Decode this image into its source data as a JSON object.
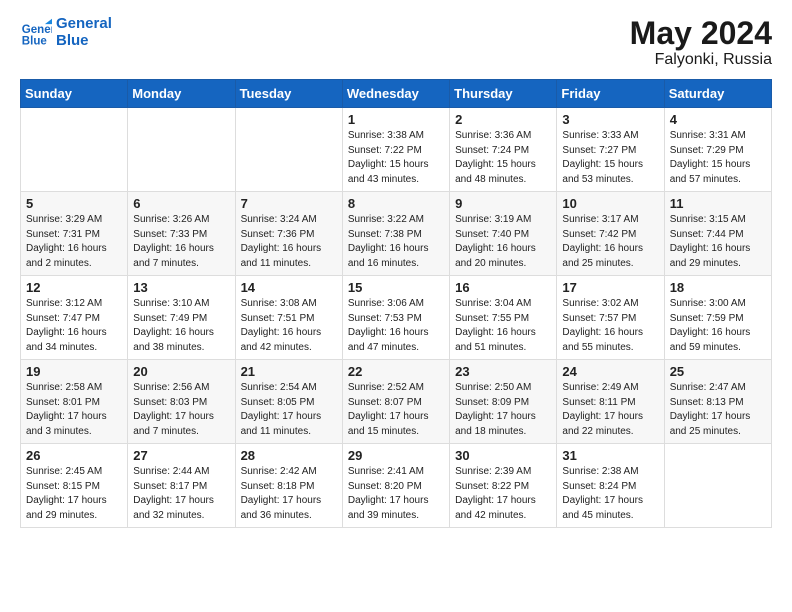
{
  "header": {
    "logo_line1": "General",
    "logo_line2": "Blue",
    "month": "May 2024",
    "location": "Falyonki, Russia"
  },
  "weekdays": [
    "Sunday",
    "Monday",
    "Tuesday",
    "Wednesday",
    "Thursday",
    "Friday",
    "Saturday"
  ],
  "weeks": [
    [
      {
        "day": "",
        "info": ""
      },
      {
        "day": "",
        "info": ""
      },
      {
        "day": "",
        "info": ""
      },
      {
        "day": "1",
        "info": "Sunrise: 3:38 AM\nSunset: 7:22 PM\nDaylight: 15 hours\nand 43 minutes."
      },
      {
        "day": "2",
        "info": "Sunrise: 3:36 AM\nSunset: 7:24 PM\nDaylight: 15 hours\nand 48 minutes."
      },
      {
        "day": "3",
        "info": "Sunrise: 3:33 AM\nSunset: 7:27 PM\nDaylight: 15 hours\nand 53 minutes."
      },
      {
        "day": "4",
        "info": "Sunrise: 3:31 AM\nSunset: 7:29 PM\nDaylight: 15 hours\nand 57 minutes."
      }
    ],
    [
      {
        "day": "5",
        "info": "Sunrise: 3:29 AM\nSunset: 7:31 PM\nDaylight: 16 hours\nand 2 minutes."
      },
      {
        "day": "6",
        "info": "Sunrise: 3:26 AM\nSunset: 7:33 PM\nDaylight: 16 hours\nand 7 minutes."
      },
      {
        "day": "7",
        "info": "Sunrise: 3:24 AM\nSunset: 7:36 PM\nDaylight: 16 hours\nand 11 minutes."
      },
      {
        "day": "8",
        "info": "Sunrise: 3:22 AM\nSunset: 7:38 PM\nDaylight: 16 hours\nand 16 minutes."
      },
      {
        "day": "9",
        "info": "Sunrise: 3:19 AM\nSunset: 7:40 PM\nDaylight: 16 hours\nand 20 minutes."
      },
      {
        "day": "10",
        "info": "Sunrise: 3:17 AM\nSunset: 7:42 PM\nDaylight: 16 hours\nand 25 minutes."
      },
      {
        "day": "11",
        "info": "Sunrise: 3:15 AM\nSunset: 7:44 PM\nDaylight: 16 hours\nand 29 minutes."
      }
    ],
    [
      {
        "day": "12",
        "info": "Sunrise: 3:12 AM\nSunset: 7:47 PM\nDaylight: 16 hours\nand 34 minutes."
      },
      {
        "day": "13",
        "info": "Sunrise: 3:10 AM\nSunset: 7:49 PM\nDaylight: 16 hours\nand 38 minutes."
      },
      {
        "day": "14",
        "info": "Sunrise: 3:08 AM\nSunset: 7:51 PM\nDaylight: 16 hours\nand 42 minutes."
      },
      {
        "day": "15",
        "info": "Sunrise: 3:06 AM\nSunset: 7:53 PM\nDaylight: 16 hours\nand 47 minutes."
      },
      {
        "day": "16",
        "info": "Sunrise: 3:04 AM\nSunset: 7:55 PM\nDaylight: 16 hours\nand 51 minutes."
      },
      {
        "day": "17",
        "info": "Sunrise: 3:02 AM\nSunset: 7:57 PM\nDaylight: 16 hours\nand 55 minutes."
      },
      {
        "day": "18",
        "info": "Sunrise: 3:00 AM\nSunset: 7:59 PM\nDaylight: 16 hours\nand 59 minutes."
      }
    ],
    [
      {
        "day": "19",
        "info": "Sunrise: 2:58 AM\nSunset: 8:01 PM\nDaylight: 17 hours\nand 3 minutes."
      },
      {
        "day": "20",
        "info": "Sunrise: 2:56 AM\nSunset: 8:03 PM\nDaylight: 17 hours\nand 7 minutes."
      },
      {
        "day": "21",
        "info": "Sunrise: 2:54 AM\nSunset: 8:05 PM\nDaylight: 17 hours\nand 11 minutes."
      },
      {
        "day": "22",
        "info": "Sunrise: 2:52 AM\nSunset: 8:07 PM\nDaylight: 17 hours\nand 15 minutes."
      },
      {
        "day": "23",
        "info": "Sunrise: 2:50 AM\nSunset: 8:09 PM\nDaylight: 17 hours\nand 18 minutes."
      },
      {
        "day": "24",
        "info": "Sunrise: 2:49 AM\nSunset: 8:11 PM\nDaylight: 17 hours\nand 22 minutes."
      },
      {
        "day": "25",
        "info": "Sunrise: 2:47 AM\nSunset: 8:13 PM\nDaylight: 17 hours\nand 25 minutes."
      }
    ],
    [
      {
        "day": "26",
        "info": "Sunrise: 2:45 AM\nSunset: 8:15 PM\nDaylight: 17 hours\nand 29 minutes."
      },
      {
        "day": "27",
        "info": "Sunrise: 2:44 AM\nSunset: 8:17 PM\nDaylight: 17 hours\nand 32 minutes."
      },
      {
        "day": "28",
        "info": "Sunrise: 2:42 AM\nSunset: 8:18 PM\nDaylight: 17 hours\nand 36 minutes."
      },
      {
        "day": "29",
        "info": "Sunrise: 2:41 AM\nSunset: 8:20 PM\nDaylight: 17 hours\nand 39 minutes."
      },
      {
        "day": "30",
        "info": "Sunrise: 2:39 AM\nSunset: 8:22 PM\nDaylight: 17 hours\nand 42 minutes."
      },
      {
        "day": "31",
        "info": "Sunrise: 2:38 AM\nSunset: 8:24 PM\nDaylight: 17 hours\nand 45 minutes."
      },
      {
        "day": "",
        "info": ""
      }
    ]
  ]
}
